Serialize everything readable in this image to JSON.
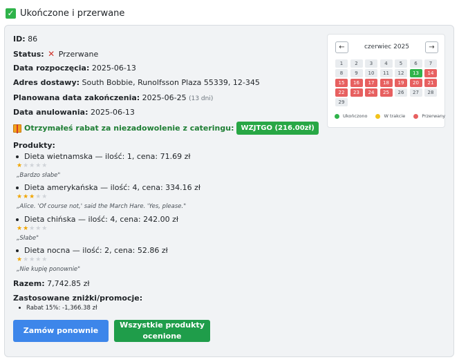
{
  "header": {
    "title": "Ukończone i przerwane"
  },
  "order": {
    "id_label": "ID:",
    "id": "86",
    "status_label": "Status:",
    "status": "Przerwane",
    "start_label": "Data rozpoczęcia:",
    "start": "2025-06-13",
    "address_label": "Adres dostawy:",
    "address": "South Bobbie, Runolfsson Plaza 55339, 12-345",
    "planned_end_label": "Planowana data zakończenia:",
    "planned_end": "2025-06-25",
    "planned_days": "(13 dni)",
    "cancel_label": "Data anulowania:",
    "cancel": "2025-06-13",
    "discount_text": "Otrzymałeś rabat za niezadowolenie z cateringu:",
    "discount_code": "WZJTGO (216.00zł)",
    "products_label": "Produkty:",
    "products": [
      {
        "text": "Dieta wietnamska — ilość: 1, cena: 71.69 zł",
        "rating": 1,
        "comment": "„Bardzo słabe\""
      },
      {
        "text": "Dieta amerykańska — ilość: 4, cena: 334.16 zł",
        "rating": 3,
        "comment": "„Alice. 'Of course not,' said the March Hare. 'Yes, please.\""
      },
      {
        "text": "Dieta chińska — ilość: 4, cena: 242.00 zł",
        "rating": 2,
        "comment": "„Słabe\""
      },
      {
        "text": "Dieta nocna — ilość: 2, cena: 52.86 zł",
        "rating": 1,
        "comment": "„Nie kupię ponownie\""
      }
    ],
    "total_label": "Razem:",
    "total": "7,742.85 zł",
    "promos_label": "Zastosowane zniżki/promocje:",
    "promos": [
      "Rabat 15%: -1,366.38 zł"
    ]
  },
  "buttons": {
    "reorder": "Zamów ponownie",
    "rated": "Wszystkie produkty ocenione"
  },
  "calendar": {
    "prev": "←",
    "next": "→",
    "title": "czerwiec 2025",
    "leading_empty": 6,
    "days": [
      {
        "d": "1",
        "s": "plain"
      },
      {
        "d": "2",
        "s": "plain"
      },
      {
        "d": "3",
        "s": "plain"
      },
      {
        "d": "4",
        "s": "plain"
      },
      {
        "d": "5",
        "s": "plain"
      },
      {
        "d": "6",
        "s": "plain"
      },
      {
        "d": "7",
        "s": "plain"
      },
      {
        "d": "8",
        "s": "plain"
      },
      {
        "d": "9",
        "s": "plain"
      },
      {
        "d": "10",
        "s": "plain"
      },
      {
        "d": "11",
        "s": "plain"
      },
      {
        "d": "12",
        "s": "plain"
      },
      {
        "d": "13",
        "s": "done"
      },
      {
        "d": "14",
        "s": "broken"
      },
      {
        "d": "15",
        "s": "broken"
      },
      {
        "d": "16",
        "s": "broken"
      },
      {
        "d": "17",
        "s": "broken"
      },
      {
        "d": "18",
        "s": "broken"
      },
      {
        "d": "19",
        "s": "broken"
      },
      {
        "d": "20",
        "s": "broken"
      },
      {
        "d": "21",
        "s": "broken"
      },
      {
        "d": "22",
        "s": "broken"
      },
      {
        "d": "23",
        "s": "broken"
      },
      {
        "d": "24",
        "s": "broken"
      },
      {
        "d": "25",
        "s": "broken"
      },
      {
        "d": "26",
        "s": "plain"
      },
      {
        "d": "27",
        "s": "plain"
      },
      {
        "d": "28",
        "s": "plain"
      },
      {
        "d": "29",
        "s": "plain"
      }
    ],
    "legend": [
      {
        "label": "Ukończono",
        "color": "#2fb34a"
      },
      {
        "label": "W trakcie",
        "color": "#f2c31b"
      },
      {
        "label": "Przerwany",
        "color": "#e76060"
      }
    ]
  },
  "colors": {
    "accent_blue": "#3d86ea",
    "accent_green": "#1f9d4a",
    "status_red": "#e76060"
  }
}
